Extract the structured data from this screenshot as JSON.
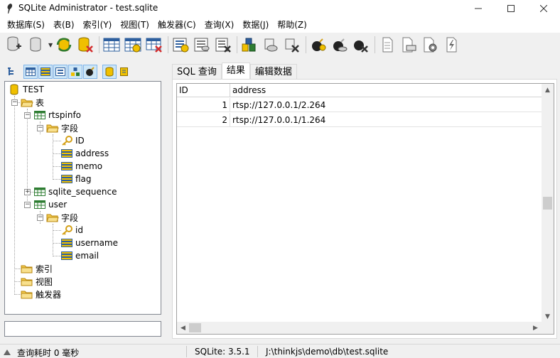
{
  "window": {
    "title": "SQLite Administrator - test.sqlite"
  },
  "menu": [
    {
      "label": "数据库(S)"
    },
    {
      "label": "表(B)"
    },
    {
      "label": "索引(Y)"
    },
    {
      "label": "视图(T)"
    },
    {
      "label": "触发器(C)"
    },
    {
      "label": "查询(X)"
    },
    {
      "label": "数据(J)"
    },
    {
      "label": "帮助(Z)"
    }
  ],
  "tree": {
    "root": "TEST",
    "tables_folder": "表",
    "tables": [
      {
        "name": "rtspinfo",
        "fields_label": "字段",
        "fields": [
          "ID",
          "address",
          "memo",
          "flag"
        ]
      },
      {
        "name": "sqlite_sequence"
      },
      {
        "name": "user",
        "fields_label": "字段",
        "fields": [
          "id",
          "username",
          "email"
        ]
      }
    ],
    "indexes_folder": "索引",
    "views_folder": "视图",
    "triggers_folder": "触发器"
  },
  "tabs": [
    {
      "label": "SQL 查询"
    },
    {
      "label": "结果"
    },
    {
      "label": "编辑数据"
    }
  ],
  "grid": {
    "columns": [
      "ID",
      "address"
    ],
    "rows": [
      [
        "1",
        "rtsp://127.0.0.1/2.264"
      ],
      [
        "2",
        "rtsp://127.0.0.1/1.264"
      ]
    ]
  },
  "status": {
    "query_time": "查询耗时 0 毫秒",
    "version": "SQLite: 3.5.1",
    "path": "J:\\thinkjs\\demo\\db\\test.sqlite"
  },
  "colors": {
    "folder": "#f2c94c",
    "table": "#2e7d32",
    "field": "#e0a800",
    "key": "#d4a017",
    "delete": "#d32f2f",
    "db": "#f0c000"
  }
}
